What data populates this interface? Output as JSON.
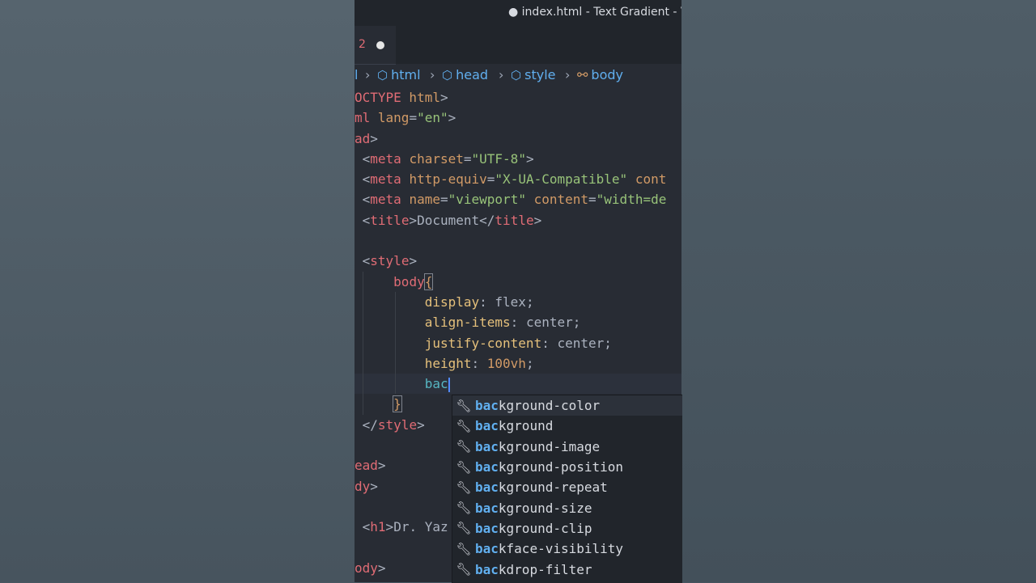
{
  "window": {
    "title": "● index.html - Text Gradient - V"
  },
  "tab": {
    "number": "2",
    "modified": "●"
  },
  "breadcrumb": {
    "first": "l",
    "items": [
      {
        "label": "html"
      },
      {
        "label": "head"
      },
      {
        "label": "style"
      },
      {
        "label": "body"
      }
    ]
  },
  "code_lines": [
    [
      "OCTYPE html>"
    ],
    [
      "ml lang=\"en\">"
    ],
    [
      "ad>"
    ],
    [
      " <meta charset=\"UTF-8\">"
    ],
    [
      " <meta http-equiv=\"X-UA-Compatible\" cont"
    ],
    [
      " <meta name=\"viewport\" content=\"width=de"
    ],
    [
      " <title>Document</title>"
    ],
    [
      ""
    ],
    [
      " <style>"
    ],
    [
      "     body{"
    ],
    [
      "         display: flex;"
    ],
    [
      "         align-items: center;"
    ],
    [
      "         justify-content: center;"
    ],
    [
      "         height: 100vh;"
    ],
    [
      "         bac"
    ],
    [
      "     }"
    ],
    [
      " </style>"
    ],
    [
      ""
    ],
    [
      "ead>"
    ],
    [
      "dy>"
    ],
    [
      ""
    ],
    [
      " <h1>Dr. Yaz"
    ],
    [
      ""
    ],
    [
      "ody>"
    ]
  ],
  "code": {
    "l1": {
      "a": "OCTYPE",
      "b": " html",
      "c": ">"
    },
    "l2": {
      "a": "ml",
      "b": " lang",
      "c": "=",
      "d": "\"en\"",
      "e": ">"
    },
    "l3": {
      "a": "ad",
      "b": ">"
    },
    "l4": {
      "a": "<",
      "b": "meta",
      "c": " charset",
      "d": "=",
      "e": "\"UTF-8\"",
      "f": ">"
    },
    "l5": {
      "a": "<",
      "b": "meta",
      "c": " http-equiv",
      "d": "=",
      "e": "\"X-UA-Compatible\"",
      "f": " cont"
    },
    "l6": {
      "a": "<",
      "b": "meta",
      "c": " name",
      "d": "=",
      "e": "\"viewport\"",
      "f": " content",
      "g": "=",
      "h": "\"width=de"
    },
    "l7": {
      "a": "<",
      "b": "title",
      "c": ">",
      "d": "Document",
      "e": "</",
      "f": "title",
      "g": ">"
    },
    "l9": {
      "a": "<",
      "b": "style",
      "c": ">"
    },
    "l10": {
      "a": "body",
      "b": "{"
    },
    "l11": {
      "a": "display",
      "b": ": ",
      "c": "flex",
      "d": ";"
    },
    "l12": {
      "a": "align-items",
      "b": ": ",
      "c": "center",
      "d": ";"
    },
    "l13": {
      "a": "justify-content",
      "b": ": ",
      "c": "center",
      "d": ";"
    },
    "l14": {
      "a": "height",
      "b": ": ",
      "c": "100vh",
      "d": ";"
    },
    "l15": {
      "a": "bac"
    },
    "l16": {
      "a": "}"
    },
    "l17": {
      "a": "</",
      "b": "style",
      "c": ">"
    },
    "l19": {
      "a": "ead",
      "b": ">"
    },
    "l20": {
      "a": "dy",
      "b": ">"
    },
    "l22": {
      "a": "<",
      "b": "h1",
      "c": ">",
      "d": "Dr. Yaz"
    },
    "l24": {
      "a": "ody",
      "b": ">"
    }
  },
  "suggestions": {
    "match": "bac",
    "items": [
      {
        "match": "bac",
        "rest": "kground-color"
      },
      {
        "match": "bac",
        "rest": "kground"
      },
      {
        "match": "bac",
        "rest": "kground-image"
      },
      {
        "match": "bac",
        "rest": "kground-position"
      },
      {
        "match": "bac",
        "rest": "kground-repeat"
      },
      {
        "match": "bac",
        "rest": "kground-size"
      },
      {
        "match": "bac",
        "rest": "kground-clip"
      },
      {
        "match": "bac",
        "rest": "kface-visibility"
      },
      {
        "match": "bac",
        "rest": "kdrop-filter"
      }
    ]
  },
  "icons": {
    "cube": "cube-icon",
    "symbol": "symbol-icon",
    "chevron": "chevron-right-icon",
    "wrench": "wrench-icon"
  },
  "colors": {
    "editor_bg": "#282c34",
    "accent": "#61afef",
    "cursor": "#528bff"
  }
}
